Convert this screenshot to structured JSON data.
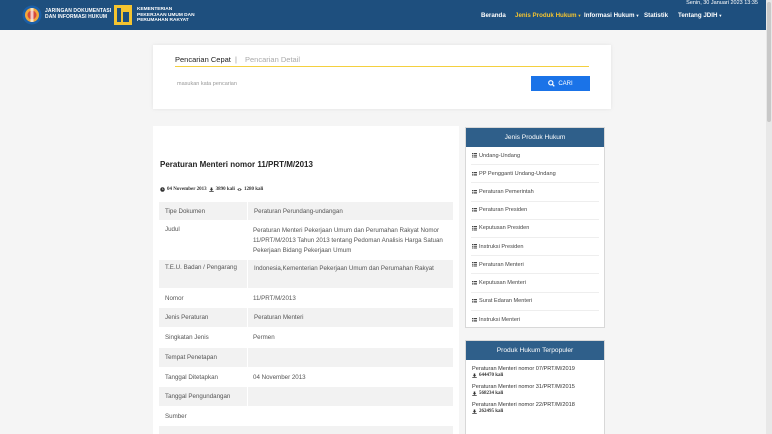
{
  "header": {
    "logo1_lines": [
      "JARINGAN DOKUMENTASI",
      "DAN INFORMASI HUKUM"
    ],
    "logo2_lines": [
      "KEMENTERIAN",
      "PEKERJAAN UMUM DAN",
      "PERUMAHAN RAKYAT"
    ],
    "date": "Senin, 30 Januari 2023 13:35",
    "nav": [
      {
        "label": "Beranda"
      },
      {
        "label": "Jenis Produk Hukum"
      },
      {
        "label": "Informasi Hukum"
      },
      {
        "label": "Statistik"
      },
      {
        "label": "Tentang JDIH"
      }
    ],
    "colors": {
      "bar": "#1e4f7e",
      "active": "#f4c430"
    }
  },
  "search": {
    "tab_quick": "Pencarian Cepat",
    "tab_sep": "|",
    "tab_detail": "Pencarian Detail",
    "placeholder": "masukan kata pencarian",
    "button_label": "CARI",
    "button_color": "#1a73e8"
  },
  "document": {
    "title": "Peraturan Menteri nomor 11/PRT/M/2013",
    "date": "04 November 2013",
    "downloads": "3890 kali",
    "views": "1280 kali",
    "rows": [
      {
        "key": "Tipe Dokumen",
        "value": "Peraturan Perundang-undangan"
      },
      {
        "key": "Judul",
        "value": "Peraturan Menteri Pekerjaan Umum dan Perumahan Rakyat Nomor 11/PRT/M/2013 Tahun 2013 tentang Pedoman Analisis Harga Satuan Pekerjaan Bidang Pekerjaan Umum"
      },
      {
        "key": "T.E.U. Badan / Pengarang",
        "value": "Indonesia,Kementerian Pekerjaan Umum dan Perumahan Rakyat"
      },
      {
        "key": "Nomor",
        "value": "11/PRT/M/2013"
      },
      {
        "key": "Jenis Peraturan",
        "value": "Peraturan Menteri"
      },
      {
        "key": "Singkatan Jenis",
        "value": "Permen"
      },
      {
        "key": "Tempat Penetapan",
        "value": ""
      },
      {
        "key": "Tanggal Ditetapkan",
        "value": "04 November 2013"
      },
      {
        "key": "Tanggal Pengundangan",
        "value": ""
      },
      {
        "key": "Sumber",
        "value": ""
      }
    ]
  },
  "sidebar": {
    "types_title": "Jenis Produk Hukum",
    "types": [
      {
        "label": "Undang-Undang"
      },
      {
        "label": "PP Pengganti Undang-Undang"
      },
      {
        "label": "Peraturan Pemerintah"
      },
      {
        "label": "Peraturan Presiden"
      },
      {
        "label": "Keputusan Presiden"
      },
      {
        "label": "Instruksi Presiden"
      },
      {
        "label": "Peraturan Menteri"
      },
      {
        "label": "Keputusan Menteri"
      },
      {
        "label": "Surat Edaran Menteri"
      },
      {
        "label": "Instruksi Menteri"
      }
    ],
    "popular_title": "Produk Hukum Terpopuler",
    "popular": [
      {
        "title": "Peraturan Menteri nomor 07/PRT/M/2019",
        "count": "644470 kali"
      },
      {
        "title": "Peraturan Menteri nomor 31/PRT/M/2015",
        "count": "568234 kali"
      },
      {
        "title": "Peraturan Menteri nomor 22/PRT/M/2018",
        "count": "262495 kali"
      }
    ],
    "head_color": "#2f5f8a"
  }
}
